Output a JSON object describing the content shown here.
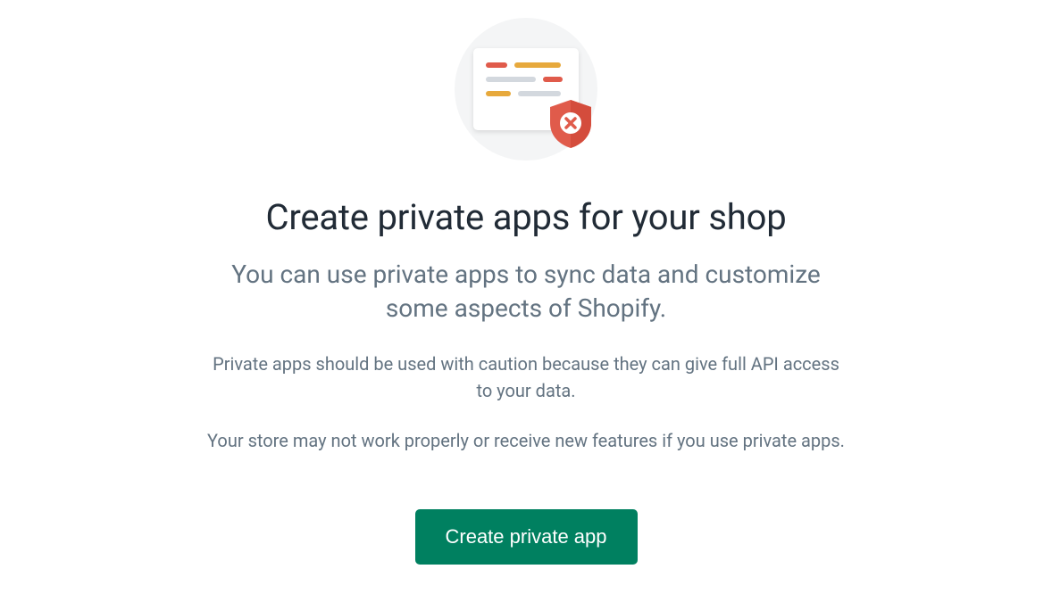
{
  "colors": {
    "accent_green": "#008060",
    "text_dark": "#212b36",
    "text_muted": "#637381",
    "illustration_red": "#e05b4b",
    "illustration_orange": "#e7a93c",
    "illustration_gray": "#d3d8de"
  },
  "main": {
    "title": "Create private apps for your shop",
    "subtitle": "You can use private apps to sync data and customize some aspects of Shopify.",
    "caution_text": "Private apps should be used with caution because they can give full API access to your data.",
    "warning_text": "Your store may not work properly or receive new features if you use private apps.",
    "button_label": "Create private app"
  }
}
